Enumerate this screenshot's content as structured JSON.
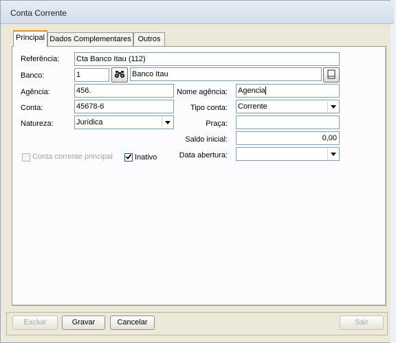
{
  "window": {
    "title": "Conta Corrente"
  },
  "tabs": [
    {
      "label": "Principal",
      "active": true
    },
    {
      "label": "Dados Complementares",
      "active": false
    },
    {
      "label": "Outros",
      "active": false
    }
  ],
  "form": {
    "referencia": {
      "label": "Referência:",
      "value": "Cta Banco Itau (112)"
    },
    "banco": {
      "label": "Banco:",
      "code": "1",
      "name": "Banco Itau"
    },
    "agencia": {
      "label": "Agência:",
      "value": "456."
    },
    "nome_agencia": {
      "label": "Nome agência:",
      "value": "Agencia"
    },
    "conta": {
      "label": "Conta:",
      "value": "45678-6"
    },
    "tipo_conta": {
      "label": "Tipo conta:",
      "value": "Corrente"
    },
    "natureza": {
      "label": "Natureza:",
      "value": "Jurídica"
    },
    "praca": {
      "label": "Praça:",
      "value": ""
    },
    "saldo_inicial": {
      "label": "Saldo inicial:",
      "value": "0,00"
    },
    "data_abertura": {
      "label": "Data abertura:",
      "value": ""
    },
    "conta_principal": {
      "label": "Conta corrente principal",
      "checked": false,
      "enabled": false
    },
    "inativo": {
      "label": "Inativo",
      "checked": true,
      "enabled": true
    }
  },
  "buttons": {
    "excluir": "Excluir",
    "gravar": "Gravar",
    "cancelar": "Cancelar",
    "sair": "Sair"
  },
  "icons": {
    "search": "binoculars-icon",
    "page": "document-icon",
    "check": "checkmark-icon"
  }
}
